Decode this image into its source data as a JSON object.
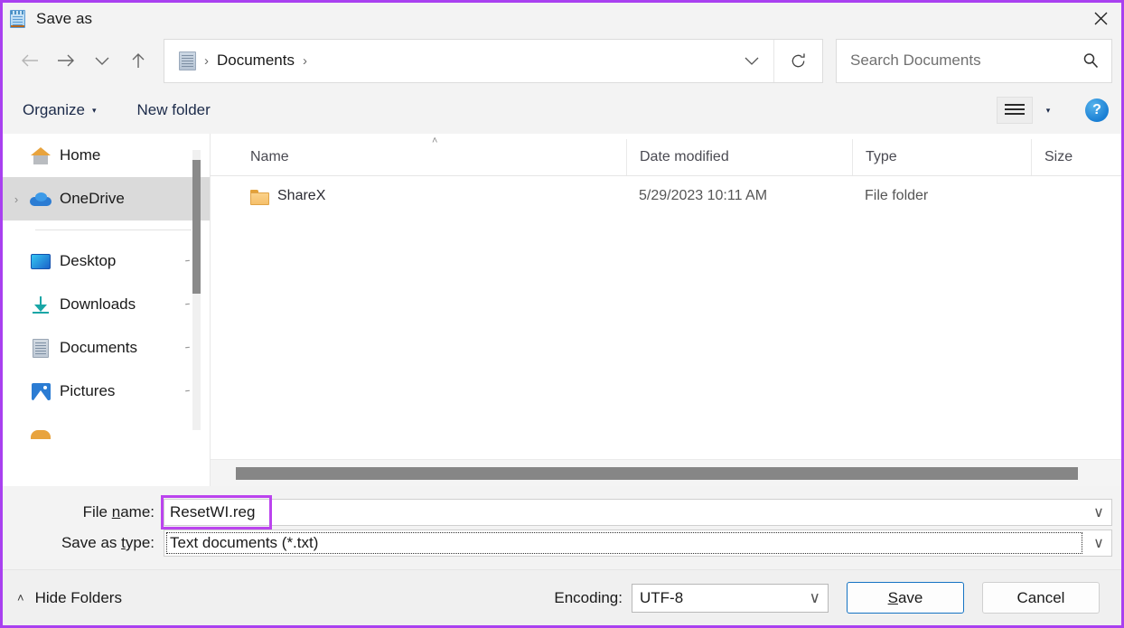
{
  "window": {
    "title": "Save as",
    "icon": "notepad-icon",
    "close_label": "✕",
    "border_color": "#a940f0"
  },
  "nav": {
    "back": "←",
    "forward": "→",
    "recent": "∨",
    "up": "↑",
    "breadcrumb": {
      "icon": "documents-folder-icon",
      "sep1": "›",
      "path": "Documents",
      "sep2": "›"
    },
    "history_caret": "∨",
    "refresh": "refresh-icon"
  },
  "search": {
    "placeholder": "Search Documents",
    "value": "",
    "icon": "search-icon"
  },
  "commandbar": {
    "organize": "Organize",
    "organize_caret": "▾",
    "new_folder": "New folder",
    "view_icon": "list-view-icon",
    "view_caret": "▾",
    "help": "?"
  },
  "sidebar": {
    "items": [
      {
        "label": "Home",
        "icon": "home-icon",
        "chevron": "",
        "pinned": false,
        "selected": false
      },
      {
        "label": "OneDrive",
        "icon": "cloud-icon",
        "chevron": "›",
        "pinned": false,
        "selected": true
      },
      {
        "label": "Desktop",
        "icon": "desktop-icon",
        "chevron": "",
        "pinned": true,
        "selected": false
      },
      {
        "label": "Downloads",
        "icon": "download-icon",
        "chevron": "",
        "pinned": true,
        "selected": false
      },
      {
        "label": "Documents",
        "icon": "document-icon",
        "chevron": "",
        "pinned": true,
        "selected": false
      },
      {
        "label": "Pictures",
        "icon": "picture-icon",
        "chevron": "",
        "pinned": true,
        "selected": false
      }
    ],
    "pin_glyph": "\""
  },
  "filelist": {
    "sort_indicator": "˄",
    "columns": [
      "Name",
      "Date modified",
      "Type",
      "Size"
    ],
    "rows": [
      {
        "name": "ShareX",
        "date_modified": "5/29/2023 10:11 AM",
        "type": "File folder",
        "size": "",
        "icon": "folder-icon"
      }
    ]
  },
  "form": {
    "file_name_label_a": "File ",
    "file_name_label_u": "n",
    "file_name_label_b": "ame:",
    "file_name_value": "ResetWI.reg",
    "file_name_caret": "∨",
    "save_as_type_label_a": "Save as ",
    "save_as_type_label_u": "t",
    "save_as_type_label_b": "ype:",
    "save_as_type_value": "Text documents (*.txt)",
    "save_as_type_caret": "∨",
    "annotation_color": "#bb44ee"
  },
  "footer": {
    "hide_folders_chevron": "˄",
    "hide_folders": "Hide Folders",
    "encoding_label": "Encoding:",
    "encoding_value": "UTF-8",
    "encoding_caret": "∨",
    "save_a": "",
    "save_u": "S",
    "save_b": "ave",
    "cancel": "Cancel"
  }
}
